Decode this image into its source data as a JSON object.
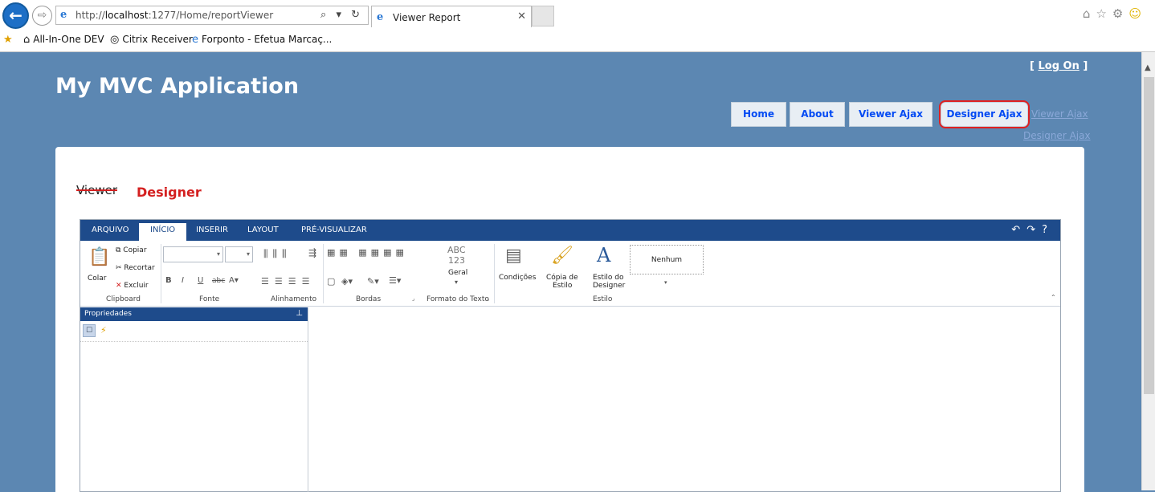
{
  "browser": {
    "url_prefix": "http://",
    "url_host": "localhost",
    "url_rest": ":1277/Home/reportViewer",
    "addr_tools": "⌕ ▾ ↻",
    "tab_title": "Viewer Report",
    "tab_close": "✕",
    "favorites": [
      {
        "label": "All-In-One DEV",
        "icon": "home-icon"
      },
      {
        "label": "Citrix Receiver",
        "icon": "citrix-icon"
      },
      {
        "label": "Forponto - Efetua Marcaç...",
        "icon": "ie-page-icon"
      }
    ]
  },
  "page": {
    "logon_open": "[",
    "logon_label": "Log On",
    "logon_close": "]",
    "title": "My MVC Application",
    "menu": [
      {
        "label": "Home"
      },
      {
        "label": "About"
      },
      {
        "label": "Viewer Ajax"
      },
      {
        "label": "Designer Ajax"
      }
    ],
    "extra_links": [
      "Viewer Ajax",
      "Designer Ajax"
    ],
    "viewer_label": "Viewer",
    "designer_label": "Designer",
    "accent": "#d42020"
  },
  "designer": {
    "tabs": [
      "ARQUIVO",
      "INÍCIO",
      "INSERIR",
      "LAYOUT",
      "PRÉ-VISUALIZAR"
    ],
    "active_tab": "INÍCIO",
    "clipboard": {
      "paste": "Colar",
      "copy": "Copiar",
      "cut": "Recortar",
      "delete": "Excluir",
      "group": "Clipboard"
    },
    "font_group": "Fonte",
    "align_group": "Alinhamento",
    "borders_group": "Bordas",
    "text_format": {
      "abc": "ABC",
      "num": "123",
      "value": "Geral",
      "group": "Formato do Texto"
    },
    "style": {
      "conditions": "Condições",
      "copy_style_1": "Cópia de",
      "copy_style_2": "Estilo",
      "designer_style_1": "Estilo do",
      "designer_style_2": "Designer",
      "selected": "Nenhum",
      "group": "Estilo"
    },
    "properties": {
      "title": "Propriedades"
    }
  }
}
